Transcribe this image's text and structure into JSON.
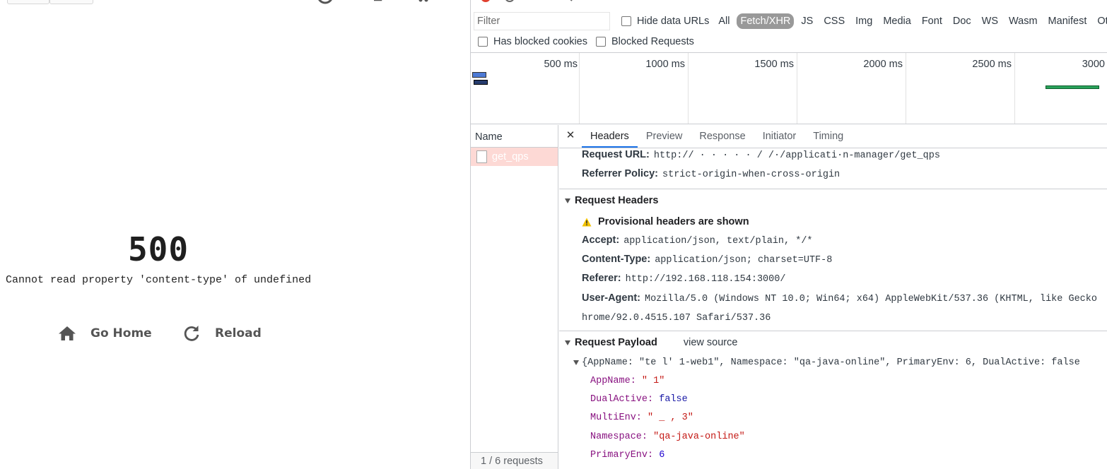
{
  "app": {
    "error_code": "500",
    "error_message": "Cannot read property 'content-type' of undefined",
    "go_home_label": "Go Home",
    "reload_label": "Reload"
  },
  "devtools": {
    "filter_placeholder": "Filter",
    "hide_data_urls_label": "Hide data URLs",
    "types": [
      "All",
      "Fetch/XHR",
      "JS",
      "CSS",
      "Img",
      "Media",
      "Font",
      "Doc",
      "WS",
      "Wasm",
      "Manifest",
      "Other"
    ],
    "active_type": "Fetch/XHR",
    "has_blocked_cookies_label": "Has blocked cookies",
    "blocked_requests_label": "Blocked Requests",
    "timeline_ticks": [
      "500 ms",
      "1000 ms",
      "1500 ms",
      "2000 ms",
      "2500 ms",
      "3000"
    ],
    "name_column": "Name",
    "request_name": "get_qps",
    "request_count": "1 / 6 requests",
    "tabs": [
      "Headers",
      "Preview",
      "Response",
      "Initiator",
      "Timing"
    ],
    "active_tab": "Headers",
    "general": {
      "request_url_key": "Request URL:",
      "request_url_value": "http://          ·   · ·       ·  ·  /      /·/applicati·n-manager/get_qps",
      "referrer_policy_key": "Referrer Policy:",
      "referrer_policy_value": "strict-origin-when-cross-origin"
    },
    "request_headers": {
      "title": "Request Headers",
      "provisional_note": "Provisional headers are shown",
      "rows": [
        {
          "key": "Accept:",
          "value": "application/json, text/plain, */*"
        },
        {
          "key": "Content-Type:",
          "value": "application/json; charset=UTF-8"
        },
        {
          "key": "Referer:",
          "value": "http://192.168.118.154:3000/"
        },
        {
          "key": "User-Agent:",
          "value": "Mozilla/5.0 (Windows NT 10.0; Win64; x64) AppleWebKit/537.36 (KHTML, like Gecko"
        }
      ],
      "user_agent_cont": "hrome/92.0.4515.107 Safari/537.36"
    },
    "request_payload": {
      "title": "Request Payload",
      "view_source": "view source",
      "summary": "{AppName: \"te     l'  1-web1\", Namespace: \"qa-java-online\", PrimaryEnv: 6, DualActive: false",
      "fields": [
        {
          "key": "AppName:",
          "value": "\"               1\"",
          "kind": "str"
        },
        {
          "key": "DualActive:",
          "value": "false",
          "kind": "kw"
        },
        {
          "key": "MultiEnv:",
          "value": "\"   _ ,   3\"",
          "kind": "str"
        },
        {
          "key": "Namespace:",
          "value": "\"qa-java-online\"",
          "kind": "str"
        },
        {
          "key": "PrimaryEnv:",
          "value": "6",
          "kind": "num"
        }
      ]
    }
  }
}
